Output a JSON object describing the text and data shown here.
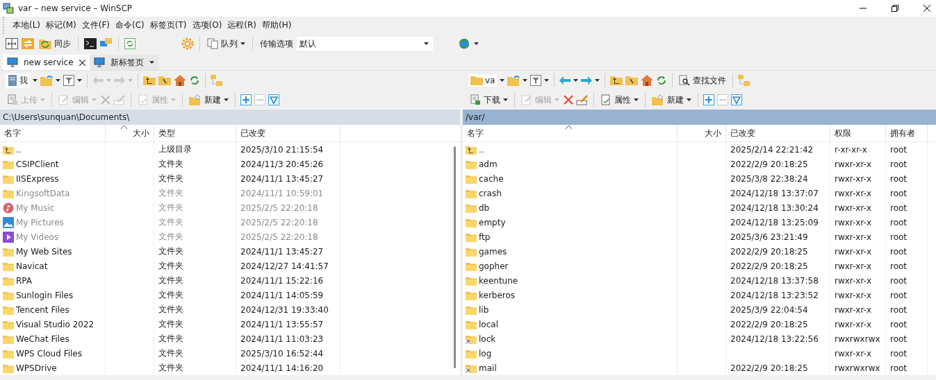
{
  "window": {
    "title": "var – new service – WinSCP"
  },
  "menu": [
    "本地(L)",
    "标记(M)",
    "文件(F)",
    "命令(C)",
    "标签页(T)",
    "选项(O)",
    "远程(R)",
    "帮助(H)"
  ],
  "toolbar": {
    "sync_label": "同步",
    "queue_label": "队列",
    "transfer_label": "传输选项",
    "transfer_value": "默认"
  },
  "tabs": [
    {
      "kind": "session",
      "label": "new service",
      "selected": true
    },
    {
      "kind": "new",
      "label": "新标签页",
      "selected": false
    }
  ],
  "left_panel": {
    "active": false,
    "drive": "我",
    "back_disabled": true,
    "forward_disabled": true,
    "actions": [
      {
        "kind": "upload",
        "label": "上传",
        "disabled": true
      },
      {
        "kind": "edit",
        "label": "编辑",
        "disabled": true
      },
      {
        "kind": "delete",
        "disabled": true
      },
      {
        "kind": "rename",
        "disabled": true
      },
      {
        "kind": "properties",
        "label": "属性",
        "disabled": true
      },
      {
        "kind": "new",
        "label": "新建",
        "disabled": false
      },
      {
        "kind": "select",
        "disabled": false
      },
      {
        "kind": "unselect",
        "disabled": true
      },
      {
        "kind": "filter",
        "disabled": false
      }
    ],
    "path": "C:\\Users\\sunquan\\Documents\\",
    "columns": [
      "名字",
      "大小",
      "类型",
      "已改变"
    ],
    "rows": [
      {
        "kind": "parent",
        "name": "..",
        "type": "上级目录",
        "changed": "2025/3/10 21:15:54",
        "hidden": false
      },
      {
        "kind": "folder",
        "name": "CSIPClient",
        "type": "文件夹",
        "changed": "2024/11/3 20:45:26",
        "hidden": false
      },
      {
        "kind": "folder",
        "name": "IISExpress",
        "type": "文件夹",
        "changed": "2024/11/1 13:45:27",
        "hidden": false
      },
      {
        "kind": "folder",
        "name": "KingsoftData",
        "type": "文件夹",
        "changed": "2024/11/1 10:59:01",
        "hidden": true
      },
      {
        "kind": "music",
        "name": "My Music",
        "type": "文件夹",
        "changed": "2025/2/5 22:20:18",
        "hidden": true
      },
      {
        "kind": "pictures",
        "name": "My Pictures",
        "type": "文件夹",
        "changed": "2025/2/5 22:20:18",
        "hidden": true
      },
      {
        "kind": "videos",
        "name": "My Videos",
        "type": "文件夹",
        "changed": "2025/2/5 22:20:18",
        "hidden": true
      },
      {
        "kind": "folder",
        "name": "My Web Sites",
        "type": "文件夹",
        "changed": "2024/11/1 13:45:27",
        "hidden": false
      },
      {
        "kind": "folder",
        "name": "Navicat",
        "type": "文件夹",
        "changed": "2024/12/27 14:41:57",
        "hidden": false
      },
      {
        "kind": "folder",
        "name": "RPA",
        "type": "文件夹",
        "changed": "2024/11/1 15:22:16",
        "hidden": false
      },
      {
        "kind": "folder",
        "name": "Sunlogin Files",
        "type": "文件夹",
        "changed": "2024/11/1 14:05:59",
        "hidden": false
      },
      {
        "kind": "folder",
        "name": "Tencent Files",
        "type": "文件夹",
        "changed": "2024/12/31 19:33:40",
        "hidden": false
      },
      {
        "kind": "folder",
        "name": "Visual Studio 2022",
        "type": "文件夹",
        "changed": "2024/11/1 13:55:57",
        "hidden": false
      },
      {
        "kind": "folder",
        "name": "WeChat Files",
        "type": "文件夹",
        "changed": "2024/11/1 11:03:23",
        "hidden": false
      },
      {
        "kind": "folder",
        "name": "WPS Cloud Files",
        "type": "文件夹",
        "changed": "2025/3/10 16:52:44",
        "hidden": false
      },
      {
        "kind": "folder",
        "name": "WPSDrive",
        "type": "文件夹",
        "changed": "2024/11/1 14:16:20",
        "hidden": false
      }
    ]
  },
  "right_panel": {
    "active": true,
    "drive": "va",
    "find_label": "查找文件",
    "back_disabled": false,
    "forward_disabled": false,
    "actions": [
      {
        "kind": "download",
        "label": "下载",
        "disabled": false
      },
      {
        "kind": "edit",
        "label": "编辑",
        "disabled": true
      },
      {
        "kind": "delete",
        "disabled": false
      },
      {
        "kind": "rename",
        "disabled": false
      },
      {
        "kind": "properties",
        "label": "属性",
        "disabled": false
      },
      {
        "kind": "new",
        "label": "新建",
        "disabled": false
      },
      {
        "kind": "select",
        "disabled": false
      },
      {
        "kind": "unselect",
        "disabled": true
      },
      {
        "kind": "filter",
        "disabled": false
      }
    ],
    "path": "/var/",
    "columns": [
      "名字",
      "大小",
      "已改变",
      "权限",
      "拥有者"
    ],
    "rows": [
      {
        "kind": "parent",
        "name": "..",
        "changed": "2025/2/14 22:21:42",
        "rights": "r-xr-xr-x",
        "owner": "root",
        "hidden": false
      },
      {
        "kind": "folder",
        "name": "adm",
        "changed": "2022/2/9 20:18:25",
        "rights": "rwxr-xr-x",
        "owner": "root",
        "hidden": false
      },
      {
        "kind": "folder",
        "name": "cache",
        "changed": "2025/3/8 22:38:24",
        "rights": "rwxr-xr-x",
        "owner": "root",
        "hidden": false
      },
      {
        "kind": "folder",
        "name": "crash",
        "changed": "2024/12/18 13:37:07",
        "rights": "rwxr-xr-x",
        "owner": "root",
        "hidden": false
      },
      {
        "kind": "folder",
        "name": "db",
        "changed": "2024/12/18 13:30:24",
        "rights": "rwxr-xr-x",
        "owner": "root",
        "hidden": false
      },
      {
        "kind": "folder",
        "name": "empty",
        "changed": "2024/12/18 13:25:09",
        "rights": "rwxr-xr-x",
        "owner": "root",
        "hidden": false
      },
      {
        "kind": "folder",
        "name": "ftp",
        "changed": "2025/3/6 23:21:49",
        "rights": "rwxr-xr-x",
        "owner": "root",
        "hidden": false
      },
      {
        "kind": "folder",
        "name": "games",
        "changed": "2022/2/9 20:18:25",
        "rights": "rwxr-xr-x",
        "owner": "root",
        "hidden": false
      },
      {
        "kind": "folder",
        "name": "gopher",
        "changed": "2022/2/9 20:18:25",
        "rights": "rwxr-xr-x",
        "owner": "root",
        "hidden": false
      },
      {
        "kind": "folder",
        "name": "keentune",
        "changed": "2024/12/18 13:37:58",
        "rights": "rwxr-xr-x",
        "owner": "root",
        "hidden": false
      },
      {
        "kind": "folder",
        "name": "kerberos",
        "changed": "2024/12/18 13:23:52",
        "rights": "rwxr-xr-x",
        "owner": "root",
        "hidden": false
      },
      {
        "kind": "folder",
        "name": "lib",
        "changed": "2025/3/9 22:04:54",
        "rights": "rwxr-xr-x",
        "owner": "root",
        "hidden": false
      },
      {
        "kind": "folder",
        "name": "local",
        "changed": "2022/2/9 20:18:25",
        "rights": "rwxr-xr-x",
        "owner": "root",
        "hidden": false
      },
      {
        "kind": "link",
        "name": "lock",
        "changed": "2024/12/18 13:22:56",
        "rights": "rwxrwxrwx",
        "owner": "root",
        "hidden": false
      },
      {
        "kind": "folder",
        "name": "log",
        "rights": "rwxr-xr-x",
        "owner": "root",
        "hidden": false
      },
      {
        "kind": "link",
        "name": "mail",
        "changed": "2022/2/9 20:18:25",
        "rights": "rwxrwxrwx",
        "owner": "root",
        "hidden": false
      }
    ]
  }
}
